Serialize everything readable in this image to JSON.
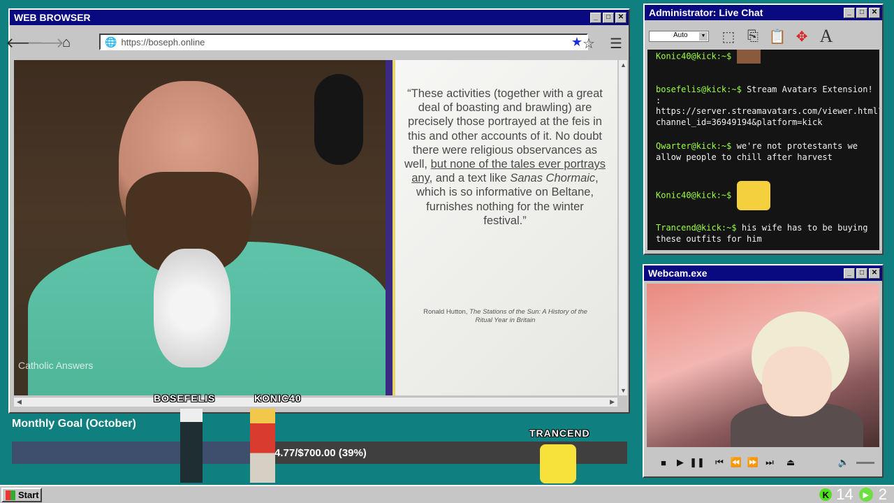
{
  "browser": {
    "title": "WEB BROWSER",
    "url": "https://boseph.online",
    "quote": {
      "part1": "“These activities (together with a great deal of boasting and brawling) are precisely those portrayed at the feis in this and other accounts of it. No doubt there were religious observances as well, ",
      "underlined": "but none of the tales ever portrays any",
      "part2": ", and a text like ",
      "italic": "Sanas Chormaic",
      "part3": ", which is so informative on Beltane, furnishes nothing for the winter festival.”"
    },
    "citation_author": "Ronald Hutton, ",
    "citation_title": "The Stations of the Sun: A History of the Ritual Year in Britain",
    "watermark": "Catholic Answers"
  },
  "chat": {
    "title": "Administrator: Live Chat",
    "font_select": "Auto",
    "messages": [
      {
        "user": "Konic40@kick:~$",
        "text": "",
        "emote": "rock-emote"
      },
      {
        "user": "bosefelis@kick:~$",
        "text": "Stream Avatars Extension! : https://server.streamavatars.com/viewer.html?channel_id=36949194&platform=kick",
        "emote": ""
      },
      {
        "user": "Qwarter@kick:~$",
        "text": "we're not protestants we allow people to chill after harvest",
        "emote": ""
      },
      {
        "user": "Konic40@kick:~$",
        "text": "",
        "emote": "pikachu-emote"
      },
      {
        "user": "Trancend@kick:~$",
        "text": "his wife has to be buying these outfits for him",
        "emote": ""
      }
    ]
  },
  "webcam": {
    "title": "Webcam.exe"
  },
  "goal": {
    "title": "Monthly Goal (October)",
    "progress_text": "$274.77/$700.00 (39%)",
    "current": 274.77,
    "target": 700.0,
    "percent": 39
  },
  "avatars": [
    "BOSEFELIS",
    "KONIC40",
    "TRANCEND"
  ],
  "taskbar": {
    "start": "Start",
    "count1": "14",
    "count2": "2"
  },
  "colors": {
    "desktop": "#0f7f7f",
    "titlebar": "#0a0a80",
    "chat_user": "#9bff3f"
  }
}
